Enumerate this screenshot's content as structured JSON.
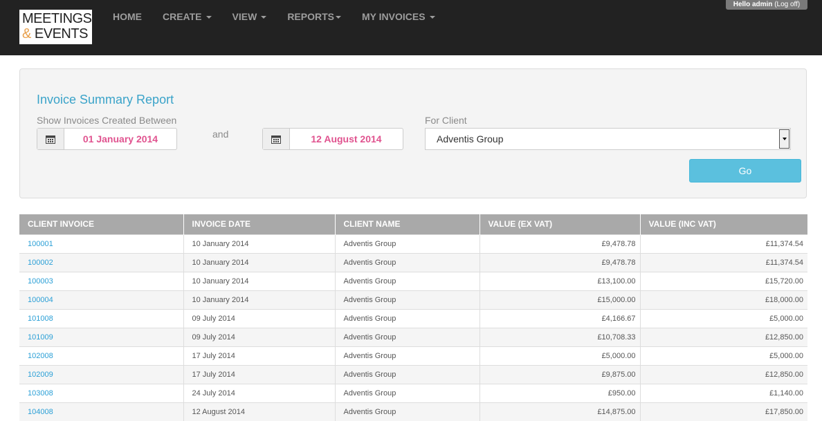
{
  "brand": {
    "line1": "MEETINGS",
    "amp": "&",
    "line2": " EVENTS"
  },
  "nav": {
    "home": "HOME",
    "create": "CREATE",
    "view": "VIEW",
    "reports": "REPORTS",
    "my_invoices": "MY INVOICES"
  },
  "user": {
    "hello": "Hello admin ",
    "logoff": "(Log off)"
  },
  "filter": {
    "title": "Invoice Summary Report",
    "created_between_label": "Show Invoices Created Between",
    "start_date": "01 January 2014",
    "and_label": "and",
    "end_date": "12 August 2014",
    "client_label": "For Client",
    "client_value": "Adventis Group",
    "go_label": "Go"
  },
  "table": {
    "headers": [
      "CLIENT INVOICE",
      "INVOICE DATE",
      "CLIENT NAME",
      "VALUE (EX VAT)",
      "VALUE (INC VAT)"
    ],
    "rows": [
      [
        "100001",
        "10 January 2014",
        "Adventis Group",
        "£9,478.78",
        "£11,374.54"
      ],
      [
        "100002",
        "10 January 2014",
        "Adventis Group",
        "£9,478.78",
        "£11,374.54"
      ],
      [
        "100003",
        "10 January 2014",
        "Adventis Group",
        "£13,100.00",
        "£15,720.00"
      ],
      [
        "100004",
        "10 January 2014",
        "Adventis Group",
        "£15,000.00",
        "£18,000.00"
      ],
      [
        "101008",
        "09 July 2014",
        "Adventis Group",
        "£4,166.67",
        "£5,000.00"
      ],
      [
        "101009",
        "09 July 2014",
        "Adventis Group",
        "£10,708.33",
        "£12,850.00"
      ],
      [
        "102008",
        "17 July 2014",
        "Adventis Group",
        "£5,000.00",
        "£5,000.00"
      ],
      [
        "102009",
        "17 July 2014",
        "Adventis Group",
        "£9,875.00",
        "£12,850.00"
      ],
      [
        "103008",
        "24 July 2014",
        "Adventis Group",
        "£950.00",
        "£1,140.00"
      ],
      [
        "104008",
        "12 August 2014",
        "Adventis Group",
        "£14,875.00",
        "£17,850.00"
      ]
    ]
  }
}
